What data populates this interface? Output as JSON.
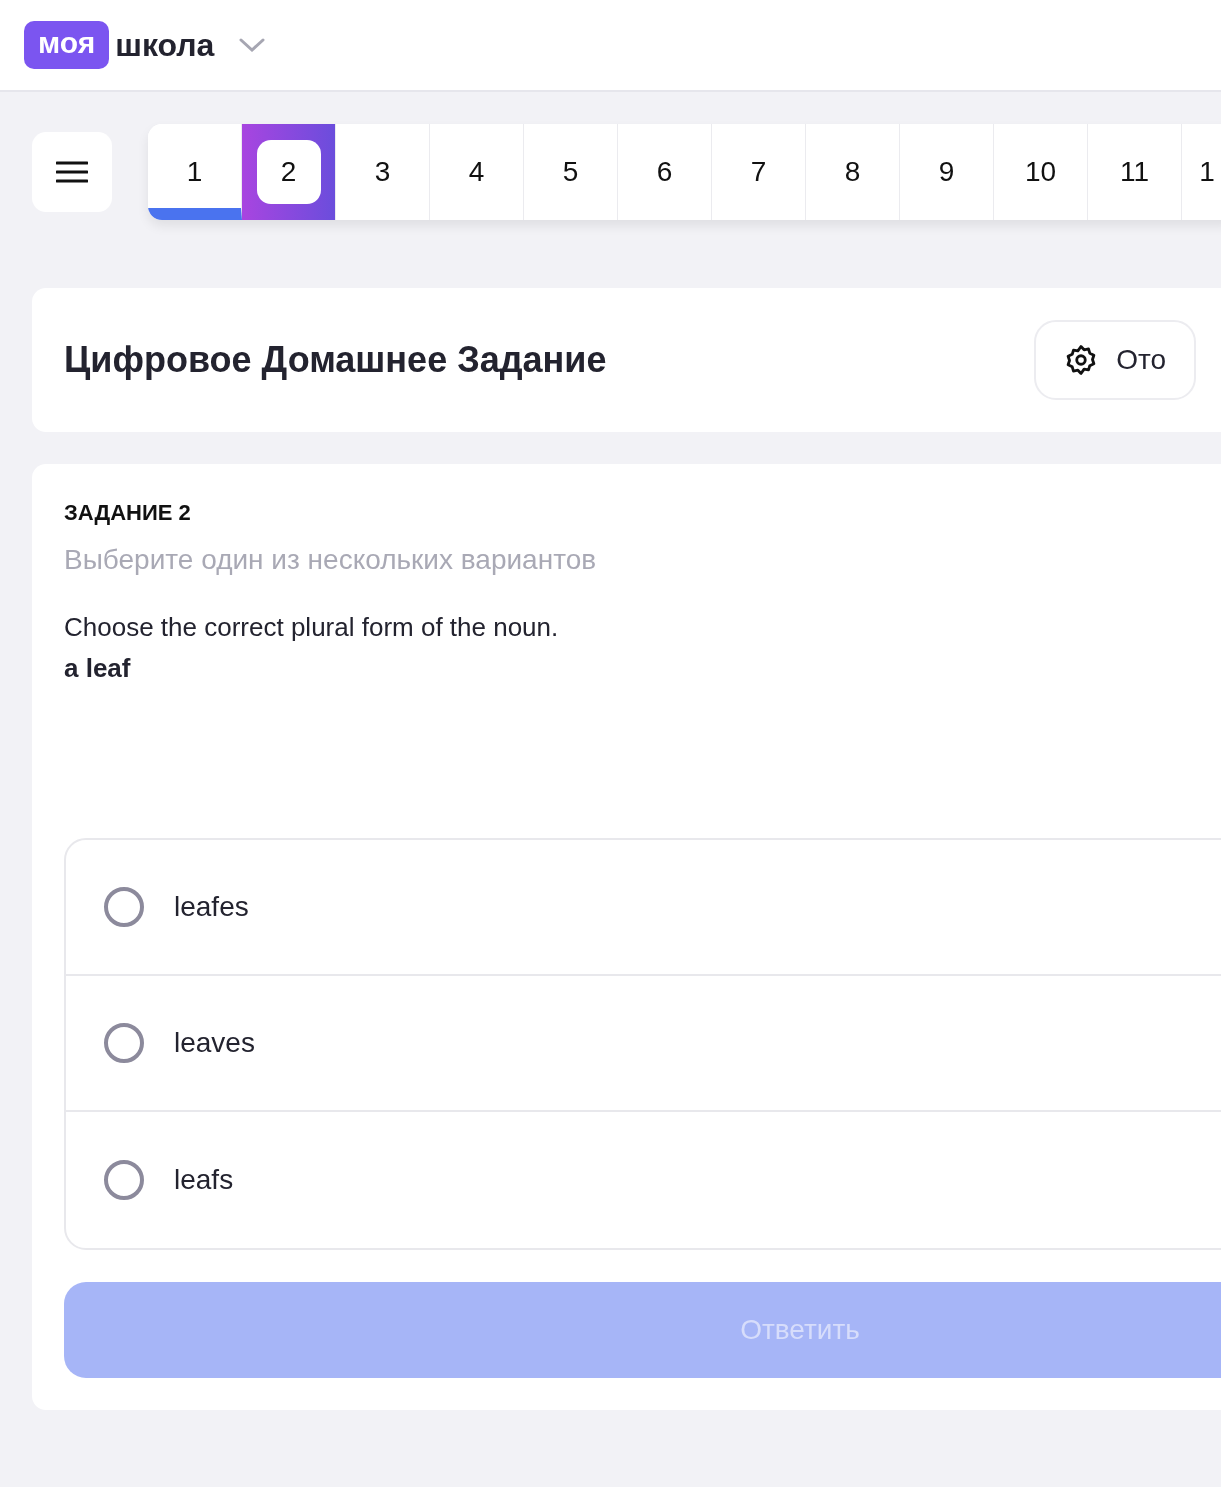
{
  "header": {
    "logo_badge": "моя",
    "logo_text": "школа"
  },
  "tabs": [
    {
      "label": "1",
      "selected": false,
      "answered": true
    },
    {
      "label": "2",
      "selected": true,
      "answered": false
    },
    {
      "label": "3",
      "selected": false,
      "answered": false
    },
    {
      "label": "4",
      "selected": false,
      "answered": false
    },
    {
      "label": "5",
      "selected": false,
      "answered": false
    },
    {
      "label": "6",
      "selected": false,
      "answered": false
    },
    {
      "label": "7",
      "selected": false,
      "answered": false
    },
    {
      "label": "8",
      "selected": false,
      "answered": false
    },
    {
      "label": "9",
      "selected": false,
      "answered": false
    },
    {
      "label": "10",
      "selected": false,
      "answered": false
    },
    {
      "label": "11",
      "selected": false,
      "answered": false
    },
    {
      "label": "1",
      "selected": false,
      "answered": false
    }
  ],
  "title_card": {
    "title": "Цифровое Домашнее Задание",
    "settings_button": "Ото"
  },
  "task": {
    "heading": "ЗАДАНИЕ 2",
    "instruction": "Выберите один из нескольких вариантов",
    "question": "Choose the correct plural form of the noun.",
    "word": "a leaf",
    "options": [
      {
        "label": "leafes",
        "selected": false
      },
      {
        "label": "leaves",
        "selected": false
      },
      {
        "label": "leafs",
        "selected": false
      }
    ],
    "submit": {
      "label": "Ответить",
      "disabled": true
    }
  }
}
